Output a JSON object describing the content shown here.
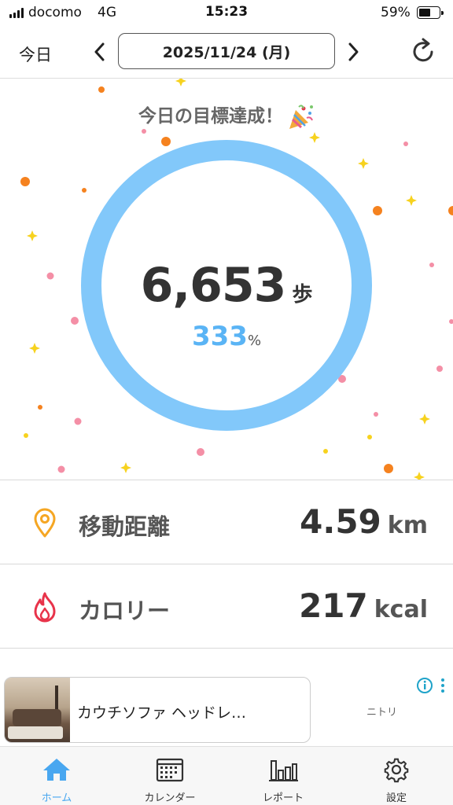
{
  "status_bar": {
    "carrier": "docomo",
    "network": "4G",
    "time": "15:23",
    "battery_percent": "59%",
    "battery_level": 0.59
  },
  "header": {
    "today_label": "今日",
    "date": "2025/11/24 (月)"
  },
  "goal": {
    "title": "今日の目標達成！",
    "steps": "6,653",
    "steps_unit": "歩",
    "percent": "333",
    "percent_symbol": "%",
    "ring_color": "#82c8fa"
  },
  "stats": [
    {
      "label": "移動距離",
      "value": "4.59",
      "unit": "km",
      "icon": "location-pin-icon",
      "icon_color": "#f5a623"
    },
    {
      "label": "カロリー",
      "value": "217",
      "unit": "kcal",
      "icon": "flame-icon",
      "icon_color": "#e8334a"
    }
  ],
  "ad": {
    "title": "カウチソファ ヘッドレ…",
    "brand": "ニトリ"
  },
  "tabs": [
    {
      "label": "ホーム",
      "icon": "home-icon",
      "active": true
    },
    {
      "label": "カレンダー",
      "icon": "calendar-icon",
      "active": false
    },
    {
      "label": "レポート",
      "icon": "bar-chart-icon",
      "active": false
    },
    {
      "label": "設定",
      "icon": "gear-icon",
      "active": false
    }
  ],
  "colors": {
    "accent": "#49a7f0",
    "ring": "#82c8fa",
    "confetti_orange": "#f5821f",
    "confetti_pink": "#f48fa6",
    "confetti_yellow": "#f7d21e"
  }
}
